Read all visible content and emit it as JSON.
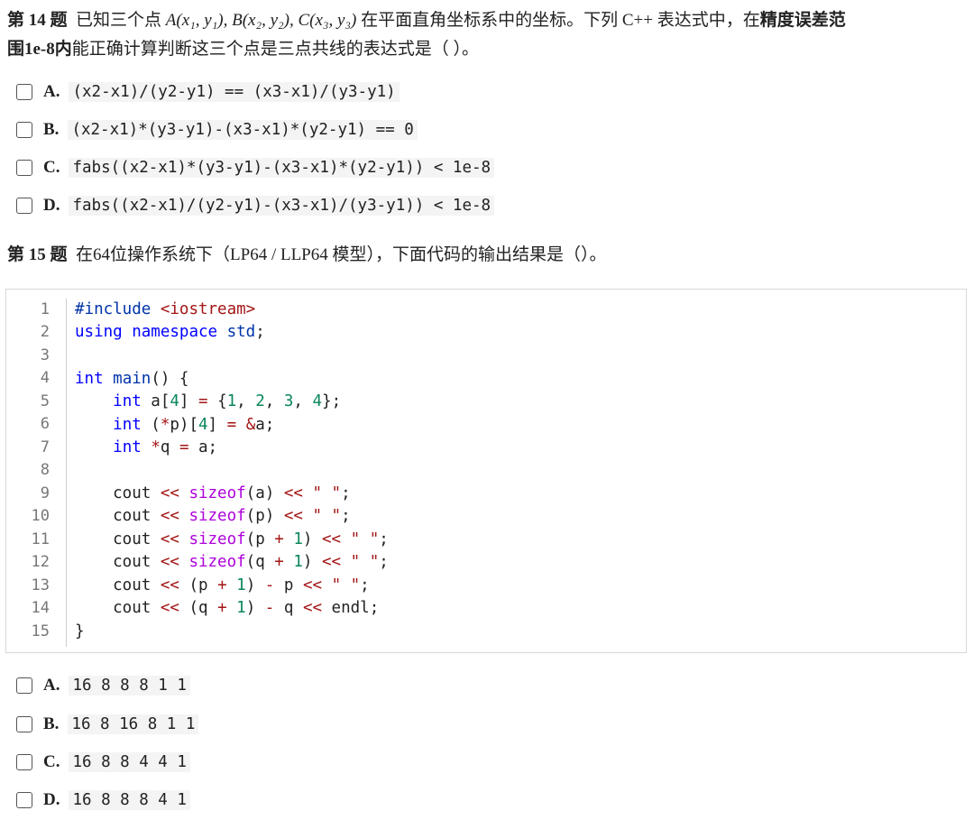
{
  "q14": {
    "label": "第 14 题",
    "text_before": "已知三个点",
    "points": "A(x₁, y₁), B(x₂, y₂), C(x₃, y₃)",
    "text_after": "在平面直角坐标系中的坐标。下列 C++ 表达式中，在",
    "bold_tail": "精度误差范",
    "line2_bold": "围1e-8内",
    "line2_rest": "能正确计算判断这三个点是三点共线的表达式是（ ）。",
    "options": [
      {
        "letter": "A.",
        "code": "(x2-x1)/(y2-y1) == (x3-x1)/(y3-y1)"
      },
      {
        "letter": "B.",
        "code": "(x2-x1)*(y3-y1)-(x3-x1)*(y2-y1) == 0"
      },
      {
        "letter": "C.",
        "code": "fabs((x2-x1)*(y3-y1)-(x3-x1)*(y2-y1)) < 1e-8"
      },
      {
        "letter": "D.",
        "code": "fabs((x2-x1)/(y2-y1)-(x3-x1)/(y3-y1)) < 1e-8"
      }
    ]
  },
  "q15": {
    "label": "第 15 题",
    "text": "在64位操作系统下（LP64 / LLP64 模型），下面代码的输出结果是（）。",
    "code_line_numbers": [
      "1",
      "2",
      "3",
      "4",
      "5",
      "6",
      "7",
      "8",
      "9",
      "10",
      "11",
      "12",
      "13",
      "14",
      "15"
    ],
    "options": [
      {
        "letter": "A.",
        "code": "16 8 8 8 1 1"
      },
      {
        "letter": "B.",
        "code": "16 8 16 8 1 1"
      },
      {
        "letter": "C.",
        "code": "16 8 8 4 4 1"
      },
      {
        "letter": "D.",
        "code": "16 8 8 8 4 1"
      }
    ]
  }
}
